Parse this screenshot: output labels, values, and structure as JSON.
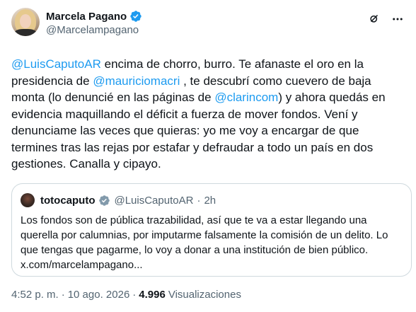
{
  "author": {
    "display_name": "Marcela Pagano",
    "handle": "@Marcelampagano"
  },
  "tweet": {
    "segments": [
      {
        "text": "@LuisCaputoAR",
        "type": "mention"
      },
      {
        "text": " encima de chorro, burro. Te afanaste el oro en la presidencia de ",
        "type": "text"
      },
      {
        "text": "@mauriciomacri",
        "type": "mention"
      },
      {
        "text": " , te descubrí como cuevero de baja monta (lo denuncié en las páginas de ",
        "type": "text"
      },
      {
        "text": "@clarincom",
        "type": "mention"
      },
      {
        "text": ") y ahora quedás en evidencia maquillando el déficit a fuerza de mover fondos. Vení y denunciame las veces que quieras: yo me voy a encargar de que termines tras las rejas por estafar y defraudar a todo un país en dos gestiones. Canalla y cipayo.",
        "type": "text"
      }
    ]
  },
  "quote": {
    "display_name": "totocaputo",
    "handle": "@LuisCaputoAR",
    "separator": "·",
    "time": "2h",
    "lines": [
      "Los fondos son de pública trazabilidad, así que te va a estar llegando una",
      "querella por calumnias, por imputarme falsamente la comisión de un delito. Lo",
      "que tengas que pagarme, lo voy a donar a una institución de bien público.",
      "x.com/marcelampagano..."
    ]
  },
  "meta": {
    "time": "4:52 p. m.",
    "separator": "·",
    "date": "10 ago. 2026",
    "separator2": "·",
    "views_count": "4.996",
    "views_label": "Visualizaciones"
  },
  "colors": {
    "link": "#1d9bf0",
    "secondary_text": "#536471",
    "border": "#cfd9de",
    "verified_badge": "#1d9bf0"
  },
  "icons": {
    "verified": "verified-badge-icon",
    "grok": "grok-icon",
    "more": "more-options-icon"
  }
}
